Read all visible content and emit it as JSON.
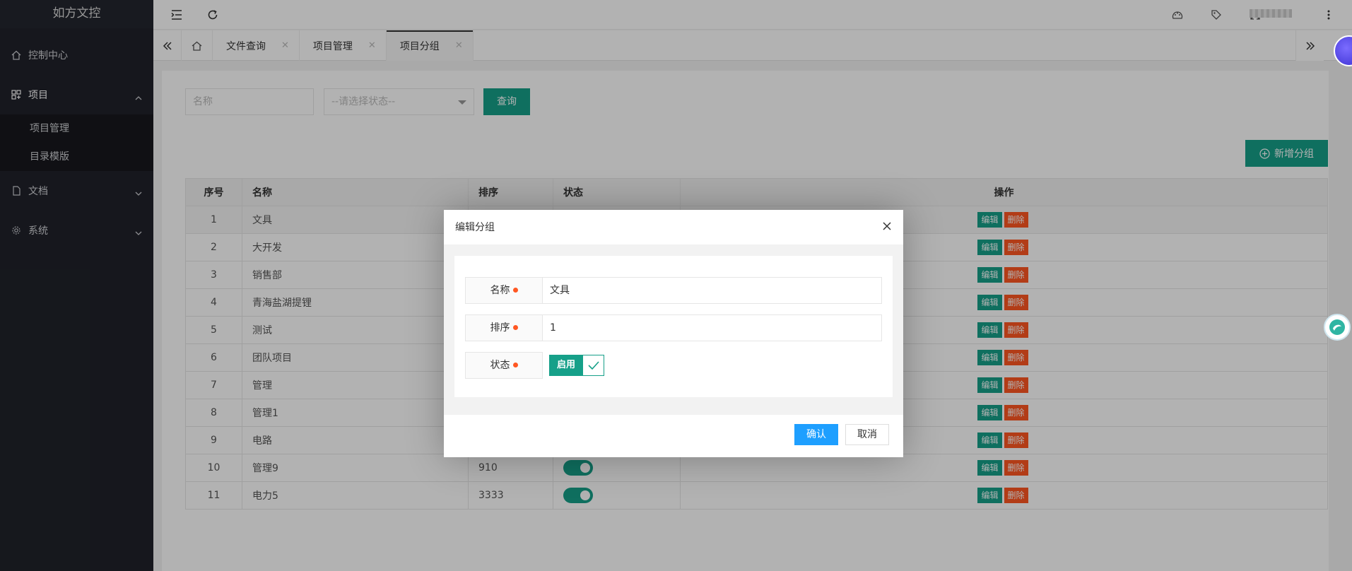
{
  "app": {
    "title": "如方文控"
  },
  "sidebar": {
    "items": [
      {
        "label": "控制中心",
        "icon": "home-icon"
      },
      {
        "label": "项目",
        "icon": "apps-icon",
        "expanded": true,
        "children": [
          {
            "label": "项目管理"
          },
          {
            "label": "目录模版"
          }
        ]
      },
      {
        "label": "文档",
        "icon": "file-icon"
      },
      {
        "label": "系统",
        "icon": "gear-icon"
      }
    ]
  },
  "tabs": [
    {
      "label": "文件查询"
    },
    {
      "label": "项目管理"
    },
    {
      "label": "项目分组",
      "active": true
    }
  ],
  "filters": {
    "name_placeholder": "名称",
    "status_placeholder": "--请选择状态--",
    "query_label": "查询",
    "add_label": "新增分组"
  },
  "table": {
    "headers": [
      "序号",
      "名称",
      "排序",
      "状态",
      "操作"
    ],
    "rows": [
      {
        "no": "1",
        "name": "文具",
        "order": "",
        "enabled": true
      },
      {
        "no": "2",
        "name": "大开发",
        "order": "",
        "enabled": true
      },
      {
        "no": "3",
        "name": "销售部",
        "order": "",
        "enabled": true
      },
      {
        "no": "4",
        "name": "青海盐湖提锂",
        "order": "",
        "enabled": true
      },
      {
        "no": "5",
        "name": "测试",
        "order": "",
        "enabled": true
      },
      {
        "no": "6",
        "name": "团队项目",
        "order": "",
        "enabled": true
      },
      {
        "no": "7",
        "name": "管理",
        "order": "",
        "enabled": true
      },
      {
        "no": "8",
        "name": "管理1",
        "order": "",
        "enabled": true
      },
      {
        "no": "9",
        "name": "电路",
        "order": "",
        "enabled": true
      },
      {
        "no": "10",
        "name": "管理9",
        "order": "910",
        "enabled": true
      },
      {
        "no": "11",
        "name": "电力5",
        "order": "3333",
        "enabled": true
      }
    ],
    "edit_label": "编辑",
    "delete_label": "删除"
  },
  "modal": {
    "title": "编辑分组",
    "name_label": "名称",
    "name_value": "文具",
    "order_label": "排序",
    "order_value": "1",
    "status_label": "状态",
    "status_value": "启用",
    "confirm_label": "确认",
    "cancel_label": "取消"
  },
  "colors": {
    "accent": "#16a089",
    "danger": "#ff5722",
    "primary": "#1e9fff",
    "sidebar": "#20222a"
  }
}
